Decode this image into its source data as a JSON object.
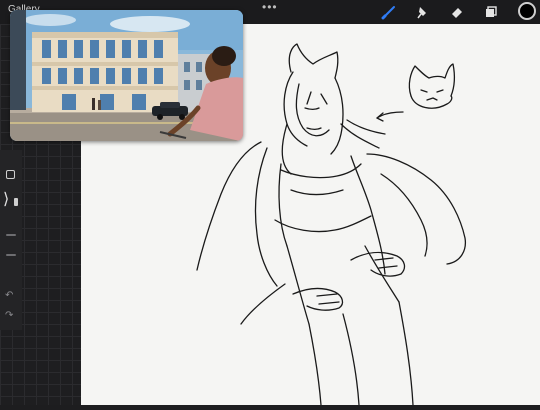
{
  "topbar": {
    "gallery_label": "Gallery",
    "more_dots": "•••",
    "tools": [
      {
        "name": "brush",
        "icon": "brush-icon",
        "active": true
      },
      {
        "name": "smudge",
        "icon": "smudge-icon",
        "active": false
      },
      {
        "name": "eraser",
        "icon": "eraser-icon",
        "active": false
      },
      {
        "name": "layers",
        "icon": "layers-icon",
        "active": false
      }
    ],
    "current_color": "#000000",
    "accent": "#2f7cf6"
  },
  "sidebar": {
    "modify_button": "square-icon",
    "expand_icon": "chevron-right-icon",
    "undo_icon": "undo-icon",
    "redo_icon": "redo-icon"
  },
  "pip_video": {
    "description_icon": "video-thumbnail"
  }
}
